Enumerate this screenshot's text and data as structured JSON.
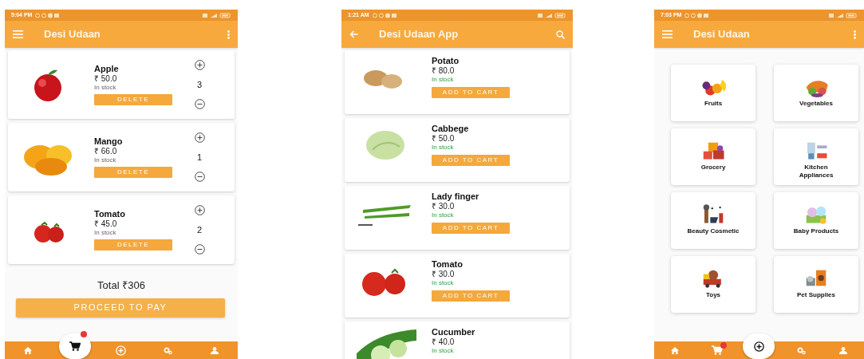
{
  "screens": [
    {
      "kind": "cart",
      "status_bar": {
        "time": "5:04 PM"
      },
      "app_bar": {
        "title": "Desi Udaan"
      },
      "items": [
        {
          "name": "Apple",
          "price": "₹ 50.0",
          "stock": "In stock",
          "quantity": "3",
          "button": "DELETE"
        },
        {
          "name": "Mango",
          "price": "₹ 66.0",
          "stock": "In stock",
          "quantity": "1",
          "button": "DELETE"
        },
        {
          "name": "Tomato",
          "price": "₹ 45.0",
          "stock": "In stock",
          "quantity": "2",
          "button": "DELETE"
        }
      ],
      "total": "Total ₹306",
      "pay_button": "PROCEED TO PAY",
      "cart_badge": true,
      "bottom_nav": [
        {
          "selected": false
        },
        {
          "selected": true
        },
        {
          "selected": false
        },
        {
          "selected": false
        },
        {
          "selected": false
        }
      ]
    },
    {
      "kind": "catalog",
      "status_bar": {
        "time": "1:21 AM"
      },
      "app_bar": {
        "title": "Desi Udaan App"
      },
      "items": [
        {
          "name": "Potato",
          "price": "₹ 80.0",
          "stock": "In stock",
          "button": "ADD TO CART"
        },
        {
          "name": "Cabbege",
          "price": "₹ 50.0",
          "stock": "In stock",
          "button": "ADD TO CART"
        },
        {
          "name": "Lady finger",
          "price": "₹ 30.0",
          "stock": "In stock",
          "button": "ADD TO CART"
        },
        {
          "name": "Tomato",
          "price": "₹ 30.0",
          "stock": "In stock",
          "button": "ADD TO CART"
        },
        {
          "name": "Cucumber",
          "price": "₹ 40.0",
          "stock": "In stock"
        }
      ]
    },
    {
      "kind": "categories",
      "status_bar": {
        "time": "7:03 PM"
      },
      "app_bar": {
        "title": "Desi Udaan"
      },
      "categories": [
        {
          "label": "Fruits"
        },
        {
          "label": "Vegetables"
        },
        {
          "label": "Grocery"
        },
        {
          "label": "Kitchen Appliances"
        },
        {
          "label": "Beauty Cosmetic"
        },
        {
          "label": "Baby Products"
        },
        {
          "label": "Toys"
        },
        {
          "label": "Pet Supplies"
        }
      ],
      "cart_badge": true,
      "bottom_nav": [
        {
          "selected": false
        },
        {
          "selected": false
        },
        {
          "selected": true
        },
        {
          "selected": false
        },
        {
          "selected": false
        }
      ]
    }
  ]
}
